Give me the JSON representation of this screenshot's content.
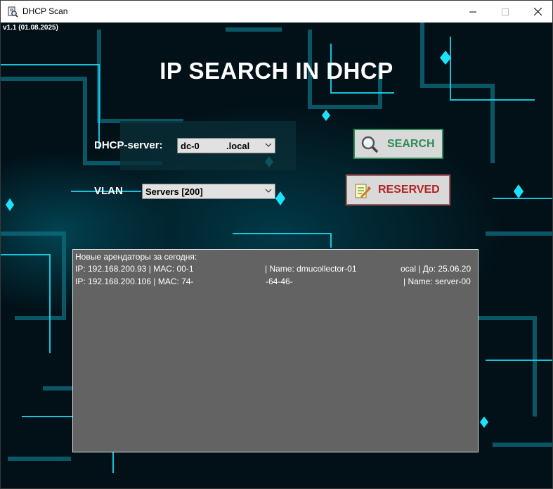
{
  "window": {
    "title": "DHCP Scan",
    "icons": {
      "app": "dhcp-scan-app-icon",
      "minimize": "minimize-icon",
      "maximize": "maximize-icon",
      "close": "close-icon"
    }
  },
  "app": {
    "version": "v1.1 (01.08.2025)",
    "title": "IP SEARCH IN DHCP"
  },
  "form": {
    "dhcp_label": "DHCP-server:",
    "dhcp_value_host": "dc-0",
    "dhcp_value_domain": ".local",
    "vlan_label": "VLAN",
    "vlan_value": "Servers [200]"
  },
  "buttons": {
    "search": "SEARCH",
    "reserved": "RESERVED",
    "search_icon": "magnifier-icon",
    "reserved_icon": "notepad-pencil-icon"
  },
  "colors": {
    "search_accent": "#2e8b57",
    "reserved_accent": "#b22222",
    "log_bg": "#636363"
  },
  "log": {
    "header": "Новые арендаторы за сегодня:",
    "rows": [
      {
        "ip": "IP: 192.168.200.93 | MAC: 00-1",
        "name": "| Name: dmucollector-01",
        "tail": "ocal | До: 25.06.20"
      },
      {
        "ip": "IP: 192.168.200.106 | MAC: 74-",
        "mid": "-64-46-",
        "name": "| Name: server-00"
      }
    ]
  }
}
